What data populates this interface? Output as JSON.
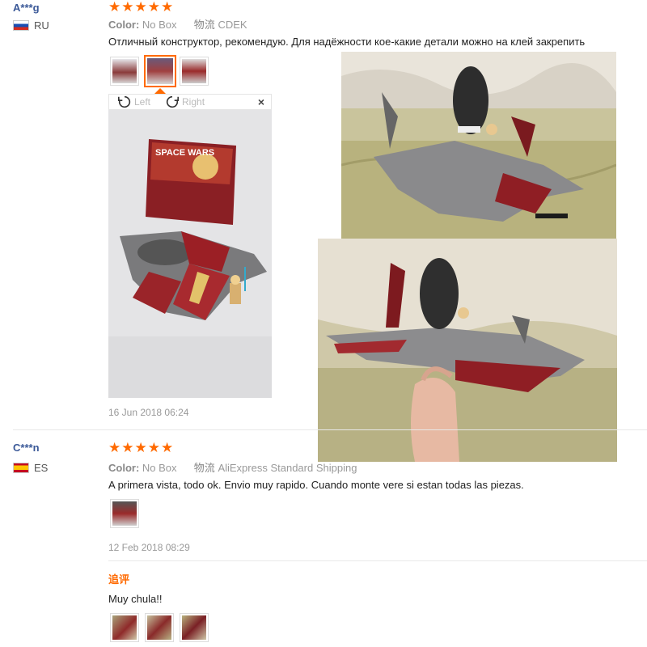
{
  "review1": {
    "user": "A***g",
    "country": "RU",
    "stars": "★★★★★",
    "color_label": "Color:",
    "color_value": "No Box",
    "shipping_label": "物流",
    "shipping_value": "CDEK",
    "text": "Отличный конструктор, рекомендую. Для надёжности кое-какие детали можно на клей закрепить",
    "viewer": {
      "left_label": "Left",
      "right_label": "Right",
      "close": "×"
    },
    "date": "16 Jun 2018 06:24"
  },
  "review2": {
    "user": "C***n",
    "country": "ES",
    "stars": "★★★★★",
    "color_label": "Color:",
    "color_value": "No Box",
    "shipping_label": "物流",
    "shipping_value": "AliExpress Standard Shipping",
    "text": "A primera vista, todo ok. Envio muy rapido. Cuando monte vere si estan todas las piezas.",
    "date": "12 Feb 2018 08:29",
    "additional_label": "追评",
    "additional_text": "Muy chula!!"
  },
  "photo_poster_text": "SPACE WARS",
  "colors": {
    "accent": "#ff6a00",
    "user": "#3b5998"
  }
}
